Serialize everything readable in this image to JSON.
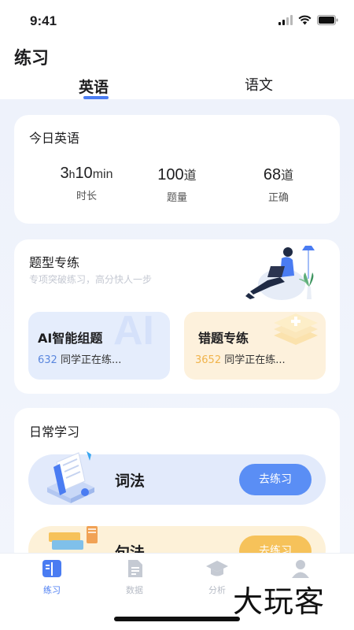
{
  "status": {
    "time": "9:41"
  },
  "page": {
    "title": "练习"
  },
  "tabs": [
    {
      "label": "英语",
      "active": true
    },
    {
      "label": "语文",
      "active": false
    }
  ],
  "today": {
    "title": "今日英语",
    "duration": {
      "hours": "3",
      "hours_unit": "h",
      "minutes": "10",
      "minutes_unit": "min",
      "label": "时长"
    },
    "questions": {
      "value": "100",
      "unit": "道",
      "label": "题量"
    },
    "correct": {
      "value": "68",
      "unit": "道",
      "label": "正确"
    }
  },
  "special": {
    "title": "题型专练",
    "subtitle": "专项突破练习，高分快人一步",
    "ai": {
      "title": "AI智能组题",
      "count": "632",
      "suffix": "同学正在练...",
      "watermark": "AI"
    },
    "mistakes": {
      "title": "错题专练",
      "count": "3652",
      "suffix": "同学正在练..."
    }
  },
  "daily": {
    "title": "日常学习",
    "items": [
      {
        "label": "词法",
        "button": "去练习"
      },
      {
        "label": "句法",
        "button": "去练习"
      }
    ]
  },
  "tabbar": [
    {
      "label": "练习",
      "icon": "book-icon",
      "active": true
    },
    {
      "label": "数据",
      "icon": "document-icon",
      "active": false
    },
    {
      "label": "分析",
      "icon": "graduation-cap-icon",
      "active": false
    },
    {
      "label": "我的",
      "icon": "person-icon",
      "active": false
    }
  ],
  "watermark": "大玩客",
  "colors": {
    "accent": "#4a7cf2",
    "orange": "#f6c25a"
  }
}
